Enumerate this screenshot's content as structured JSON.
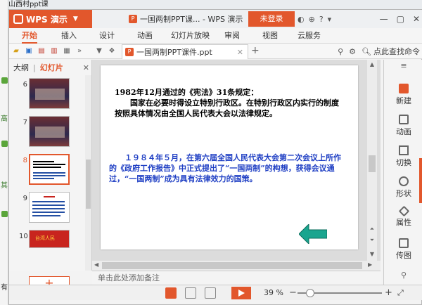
{
  "background": {
    "title_fragment": "游山西村ppt课",
    "left_fragments": [
      "高",
      "其",
      "有"
    ]
  },
  "app": {
    "name": "WPS 演示",
    "document_title": "一国两制PPT课... - WPS 演示",
    "login_label": "未登录"
  },
  "menu": {
    "items": [
      "开始",
      "插入",
      "设计",
      "动画",
      "幻灯片放映",
      "审阅",
      "视图",
      "云服务"
    ],
    "active": "开始"
  },
  "toolbar": {
    "tab_label": "一国两制PPT课件.ppt",
    "search_placeholder": "点此查找命令"
  },
  "left_panel": {
    "tab_outline": "大纲",
    "tab_slides": "幻灯片",
    "slides": [
      {
        "num": "6",
        "kind": "photo"
      },
      {
        "num": "7",
        "kind": "photo"
      },
      {
        "num": "8",
        "kind": "text",
        "selected": true
      },
      {
        "num": "9",
        "kind": "text"
      },
      {
        "num": "10",
        "kind": "red",
        "caption": "台湾人民"
      }
    ]
  },
  "slide": {
    "title": "1982年12月通过的《宪法》31条规定：",
    "para1": "国家在必要时得设立特别行政区。在特别行政区内实行的制度按照具体情况由全国人民代表大会以法律规定。",
    "para2": "１９８４年５月，在第六届全国人民代表大会第二次会议上所作的《政府工作报告》中正式提出了“一国两制”的构想，获得会议通过，“一国两制”成为具有法律效力的国策。"
  },
  "notes": {
    "placeholder": "单击此处添加备注"
  },
  "right_panel": {
    "items": [
      "新建",
      "动画",
      "切换",
      "形状",
      "属性",
      "传图"
    ]
  },
  "status": {
    "zoom": "39 %"
  },
  "colors": {
    "accent": "#e2572c",
    "slide_blue": "#1f3fc4",
    "arrow_fill": "#1aa58f"
  }
}
